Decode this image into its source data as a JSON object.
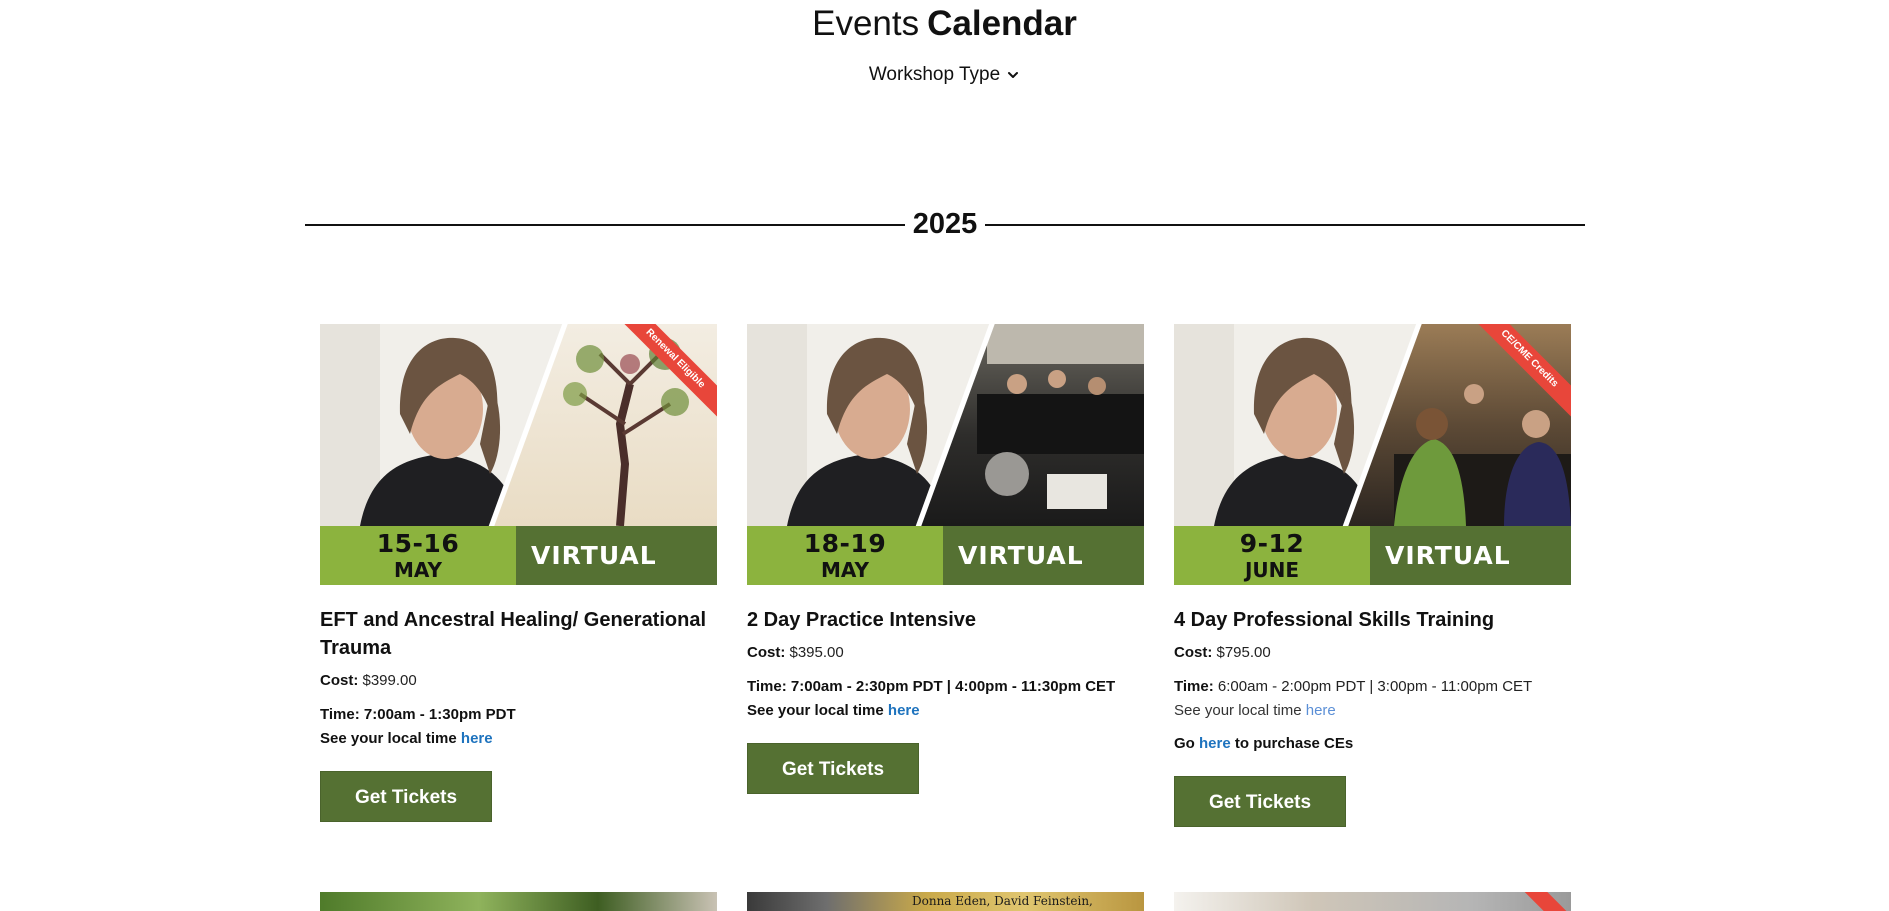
{
  "header": {
    "title_light": "Events",
    "title_bold": "Calendar",
    "filter_label": "Workshop Type"
  },
  "year": "2025",
  "events": [
    {
      "ribbon": "Renewal Eligible",
      "date_days": "15-16",
      "date_month": "MAY",
      "format": "VIRTUAL",
      "title": "EFT and Ancestral Healing/ Generational Trauma",
      "cost_label": "Cost:",
      "cost_value": "$399.00",
      "time_text": "Time: 7:00am - 1:30pm PDT",
      "local_prefix": "See your local time",
      "local_link": "here",
      "button": "Get Tickets"
    },
    {
      "ribbon": "",
      "date_days": "18-19",
      "date_month": "MAY",
      "format": "VIRTUAL",
      "title": "2 Day Practice Intensive",
      "cost_label": "Cost:",
      "cost_value": "$395.00",
      "time_text": "Time: 7:00am - 2:30pm PDT | 4:00pm - 11:30pm CET",
      "local_prefix": "See your local time",
      "local_link": "here",
      "button": "Get Tickets"
    },
    {
      "ribbon": "CE/CME Credits",
      "date_days": "9-12",
      "date_month": "JUNE",
      "format": "VIRTUAL",
      "title": "4 Day Professional Skills Training",
      "cost_label": "Cost:",
      "cost_value": "$795.00",
      "time_label": "Time:",
      "time_value": "6:00am - 2:00pm PDT | 3:00pm - 11:00pm CET",
      "local_prefix": "See your local time",
      "local_link": "here",
      "purchase_prefix": "Go",
      "purchase_link": "here",
      "purchase_suffix": "to purchase CEs",
      "button": "Get Tickets"
    }
  ],
  "next_row": {
    "peek_text": "Donna Eden, David Feinstein,"
  },
  "colors": {
    "date_green": "#8cb33e",
    "virtual_green": "#557133",
    "button_green": "#557133",
    "ribbon_red": "#e8463a",
    "link_blue": "#1e73be"
  }
}
